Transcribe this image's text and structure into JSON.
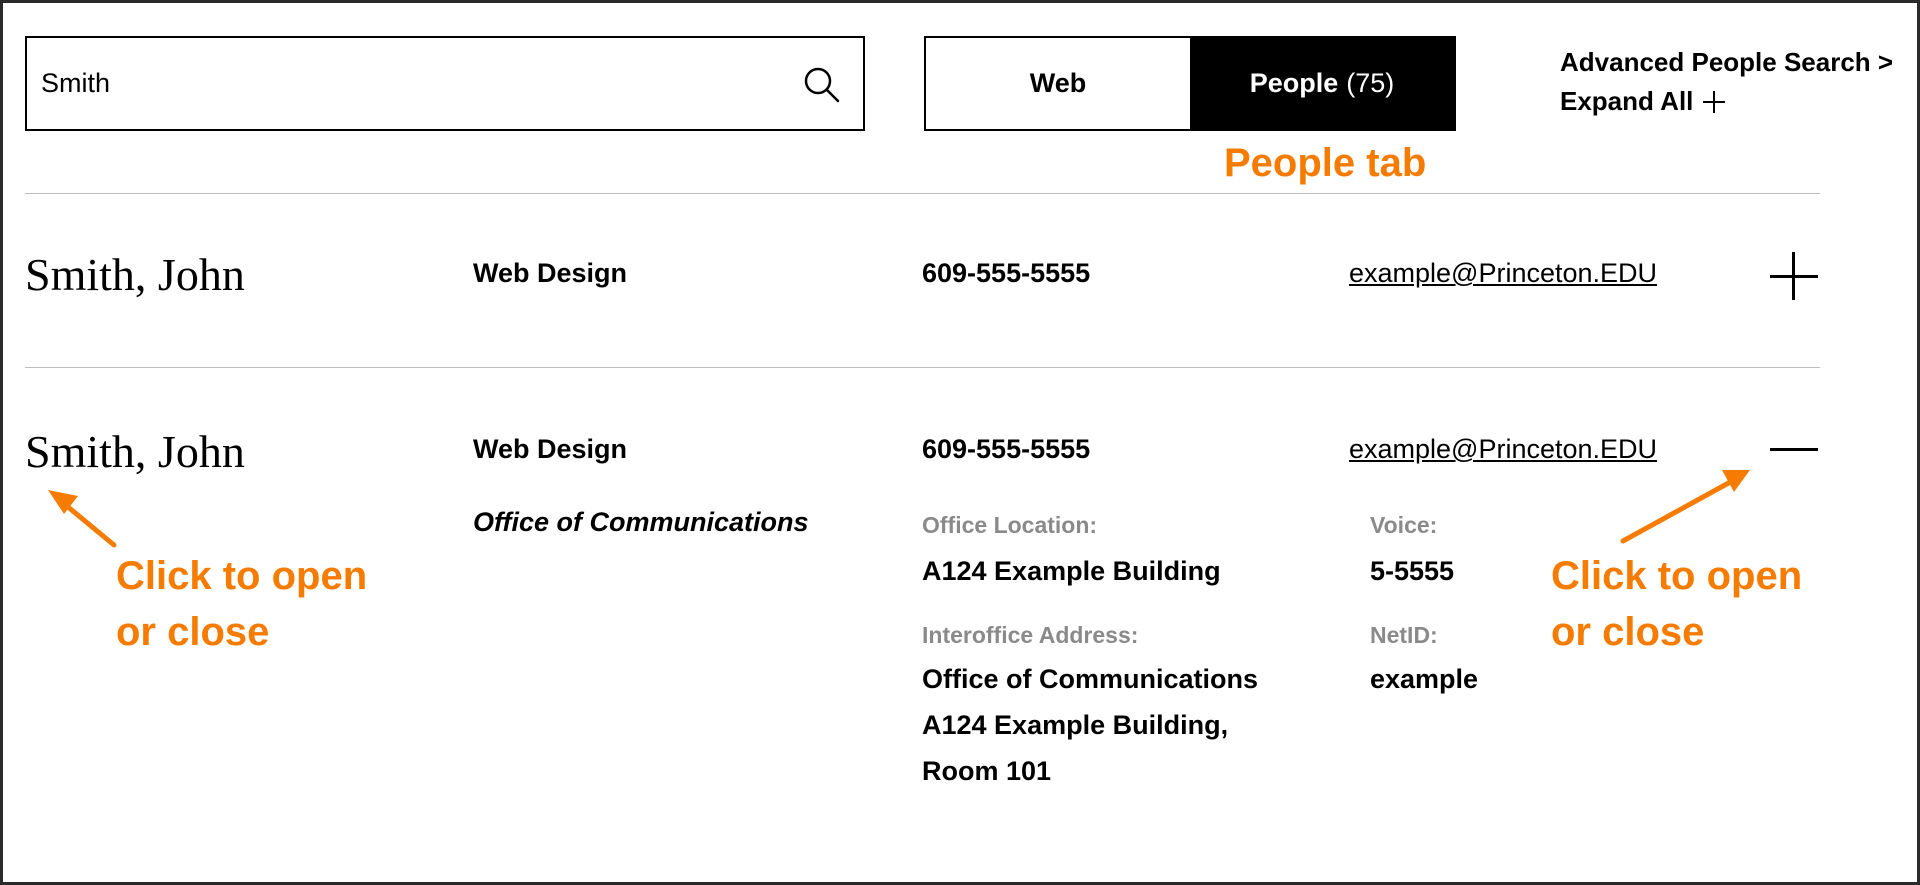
{
  "search": {
    "value": "Smith",
    "icon": "search-icon"
  },
  "tabs": [
    {
      "label": "Web"
    },
    {
      "label": "People",
      "count": "(75)",
      "active": true
    }
  ],
  "links": {
    "advanced": "Advanced People Search >",
    "expand": "Expand All"
  },
  "annotations": {
    "people_tab": "People tab",
    "left_line1": "Click to open",
    "left_line2": "or close",
    "right_line1": "Click to open",
    "right_line2": "or close",
    "color": "#f57c00"
  },
  "results": [
    {
      "name": "Smith, John",
      "department": "Web Design",
      "phone": "609-555-5555",
      "email": "example@Princeton.EDU",
      "expanded": false
    },
    {
      "name": "Smith, John",
      "department": "Web Design",
      "phone": "609-555-5555",
      "email": "example@Princeton.EDU",
      "expanded": true,
      "details": {
        "office": "Office of Communications",
        "office_location_label": "Office Location:",
        "office_location": "A124 Example Building",
        "interoffice_label": "Interoffice Address:",
        "interoffice_line1": "Office of Communications",
        "interoffice_line2": "A124 Example Building,",
        "interoffice_line3": "Room 101",
        "voice_label": "Voice:",
        "voice": "5-5555",
        "netid_label": "NetID:",
        "netid": "example"
      }
    }
  ]
}
